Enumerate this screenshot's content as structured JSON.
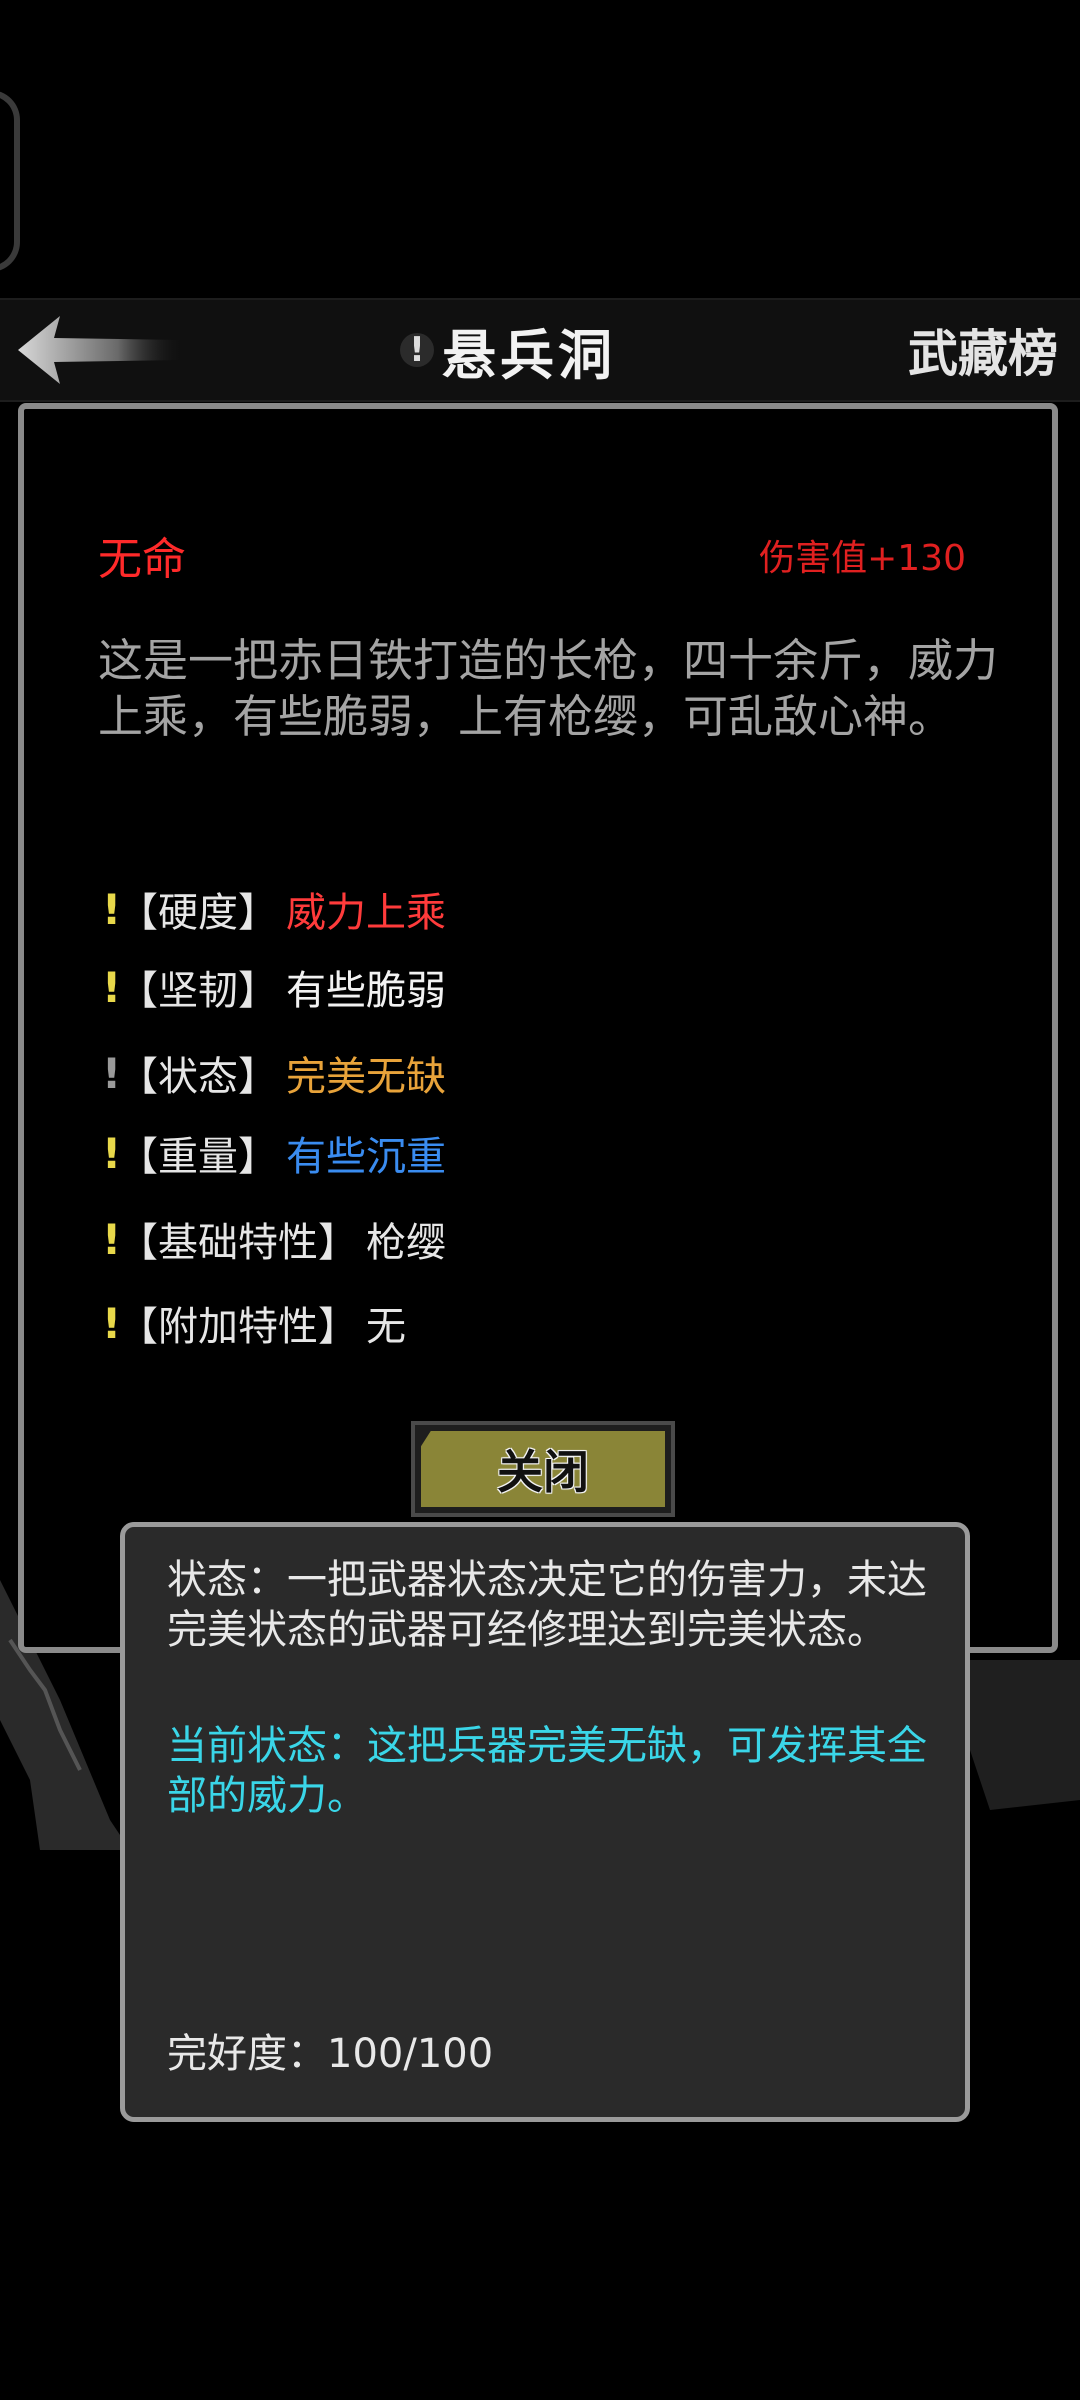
{
  "header": {
    "title_icon": "!",
    "title": "悬兵洞",
    "right_link": "武藏榜",
    "back_icon": "arrow-left-icon"
  },
  "item": {
    "name": "无命",
    "damage": "伤害值+130",
    "description": "这是一把赤日铁打造的长枪，四十余斤，威力上乘，有些脆弱，上有枪缨，可乱敌心神。",
    "attributes": [
      {
        "mark": "!",
        "mark_color": "#e8d84a",
        "label": "【硬度】",
        "value": "威力上乘",
        "value_color": "#ff3b3b"
      },
      {
        "mark": "!",
        "mark_color": "#e8d84a",
        "label": "【坚韧】",
        "value": "有些脆弱",
        "value_color": "#f2f2f2"
      },
      {
        "mark": "!",
        "mark_color": "#9a9a9a",
        "label": "【状态】",
        "value": "完美无缺",
        "value_color": "#e8a33a"
      },
      {
        "mark": "!",
        "mark_color": "#e8d84a",
        "label": "【重量】",
        "value": "有些沉重",
        "value_color": "#3a8cf0"
      },
      {
        "mark": "!",
        "mark_color": "#e8d84a",
        "label": "【基础特性】",
        "value": "枪缨",
        "value_color": "#e6e6e6"
      },
      {
        "mark": "!",
        "mark_color": "#e8d84a",
        "label": "【附加特性】",
        "value": "无",
        "value_color": "#e6e6e6"
      }
    ],
    "close_label": "关闭"
  },
  "tooltip": {
    "text": "状态：一把武器状态决定它的伤害力，未达完美状态的武器可经修理达到完美状态。",
    "current": "当前状态：这把兵器完美无缺，可发挥其全部的威力。",
    "integrity": "完好度：100/100"
  }
}
